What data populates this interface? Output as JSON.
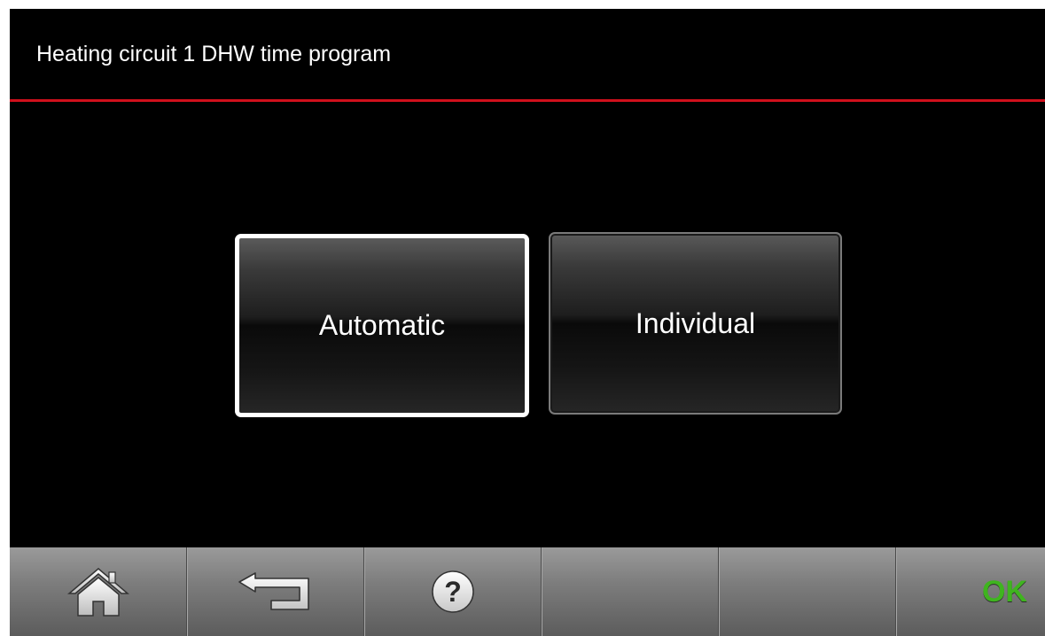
{
  "header": {
    "title": "Heating circuit 1 DHW time program"
  },
  "options": [
    {
      "label": "Automatic",
      "selected": true
    },
    {
      "label": "Individual",
      "selected": false
    }
  ],
  "footer": {
    "home_icon": "home-icon",
    "back_icon": "back-arrow-icon",
    "help_icon": "help-icon",
    "ok_label": "OK"
  },
  "colors": {
    "accent_rule": "#d0101c",
    "ok": "#3fb41f",
    "background": "#000000"
  }
}
